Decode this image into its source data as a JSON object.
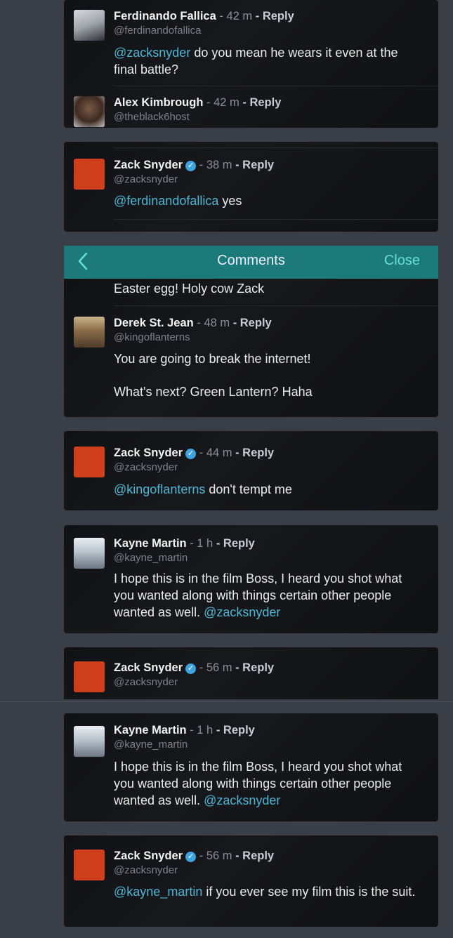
{
  "topbar": {
    "title": "Comments",
    "close_label": "Close"
  },
  "c1": {
    "name": "Ferdinando Fallica",
    "time": "- 42 m",
    "reply": "- Reply",
    "handle": "@ferdinandofallica",
    "mention": "@zacksnyder",
    "text": " do you mean he wears it even at the final battle?"
  },
  "c2": {
    "name": "Alex Kimbrough",
    "time": "- 42 m",
    "reply": "- Reply",
    "handle": "@theblack6host"
  },
  "c3": {
    "name": "Zack Snyder",
    "time": "- 38 m",
    "reply": "- Reply",
    "handle": "@zacksnyder",
    "mention": "@ferdinandofallica",
    "text": " yes"
  },
  "c4": {
    "partial_text": "Easter egg! Holy cow Zack"
  },
  "c5": {
    "name": "Derek St. Jean",
    "time": "- 48 m",
    "reply": "- Reply",
    "handle": "@kingoflanterns",
    "text1": "You are going to break the internet!",
    "text2": "What's next? Green Lantern? Haha"
  },
  "c6": {
    "name": "Zack Snyder",
    "time": "- 44 m",
    "reply": "- Reply",
    "handle": "@zacksnyder",
    "mention": "@kingoflanterns",
    "text": " don't tempt me"
  },
  "c7": {
    "name": "Kayne Martin",
    "time": "- 1 h",
    "reply": "- Reply",
    "handle": "@kayne_martin",
    "text": "I hope this is in the film Boss, I heard you shot what you wanted along with things certain other people wanted as well. ",
    "mention": "@zacksnyder"
  },
  "c8": {
    "name": "Zack Snyder",
    "time": "- 56 m",
    "reply": "- Reply",
    "handle": "@zacksnyder"
  },
  "c9": {
    "name": "Kayne Martin",
    "time": "- 1 h",
    "reply": "- Reply",
    "handle": "@kayne_martin",
    "text": "I hope this is in the film Boss, I heard you shot what you wanted along with things certain other people wanted as well. ",
    "mention": "@zacksnyder"
  },
  "c10": {
    "name": "Zack Snyder",
    "time": "- 56 m",
    "reply": "- Reply",
    "handle": "@zacksnyder",
    "mention": "@kayne_martin",
    "text": " if you ever see my film this is the suit."
  },
  "icons": {
    "verified": "verified-badge-icon",
    "back": "chevron-left-icon"
  },
  "colors": {
    "mention": "#4fb7d4",
    "header_bar": "#1c7b7a",
    "close": "#67e0d2",
    "background": "#3a3e47"
  }
}
